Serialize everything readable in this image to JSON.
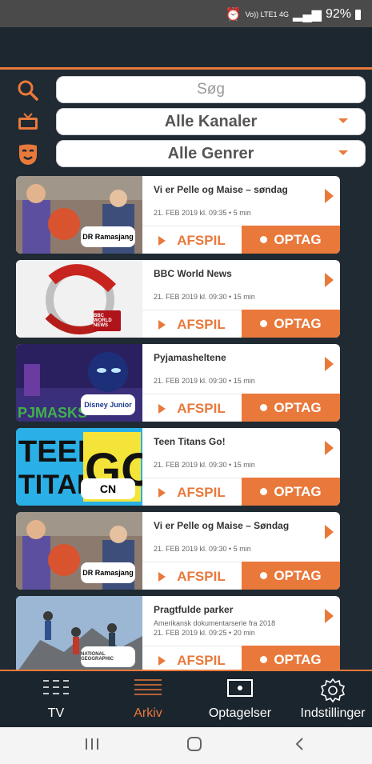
{
  "status_bar": {
    "network_label": "Vo)) LTE1 4G",
    "battery": "92%"
  },
  "filters": {
    "search_placeholder": "Søg",
    "channels": "Alle Kanaler",
    "genres": "Alle Genrer"
  },
  "programs": [
    {
      "title": "Vi er Pelle og Maise – søndag",
      "desc": "",
      "meta": "21. FEB 2019 kl. 09:35 • 5 min",
      "channel_logo": "DR Ramasjang",
      "play": "AFSPIL",
      "record": "OPTAG"
    },
    {
      "title": "BBC World News",
      "desc": "",
      "meta": "21. FEB 2019 kl. 09:30 • 15 min",
      "channel_logo": "BBC WORLD NEWS",
      "play": "AFSPIL",
      "record": "OPTAG"
    },
    {
      "title": "Pyjamasheltene",
      "desc": "",
      "meta": "21. FEB 2019 kl. 09:30 • 15 min",
      "channel_logo": "Disney Junior",
      "play": "AFSPIL",
      "record": "OPTAG"
    },
    {
      "title": "Teen Titans Go!",
      "desc": "",
      "meta": "21. FEB 2019 kl. 09:30 • 15 min",
      "channel_logo": "CN",
      "play": "AFSPIL",
      "record": "OPTAG"
    },
    {
      "title": "Vi er Pelle og Maise – Søndag",
      "desc": "",
      "meta": "21. FEB 2019 kl. 09:30 • 5 min",
      "channel_logo": "DR Ramasjang",
      "play": "AFSPIL",
      "record": "OPTAG"
    },
    {
      "title": "Pragtfulde parker",
      "desc": "Amerikansk dokumentarserie fra 2018",
      "meta": "21. FEB 2019 kl. 09:25 • 20 min",
      "channel_logo": "NATIONAL GEOGRAPHIC",
      "play": "AFSPIL",
      "record": "OPTAG"
    }
  ],
  "tabs": [
    {
      "label": "TV",
      "icon": "grid-list-icon"
    },
    {
      "label": "Arkiv",
      "icon": "archive-lines-icon"
    },
    {
      "label": "Optagelser",
      "icon": "recordings-icon"
    },
    {
      "label": "Indstillinger",
      "icon": "gear-icon"
    }
  ],
  "colors": {
    "accent": "#e9793b",
    "background": "#1f2a33"
  }
}
